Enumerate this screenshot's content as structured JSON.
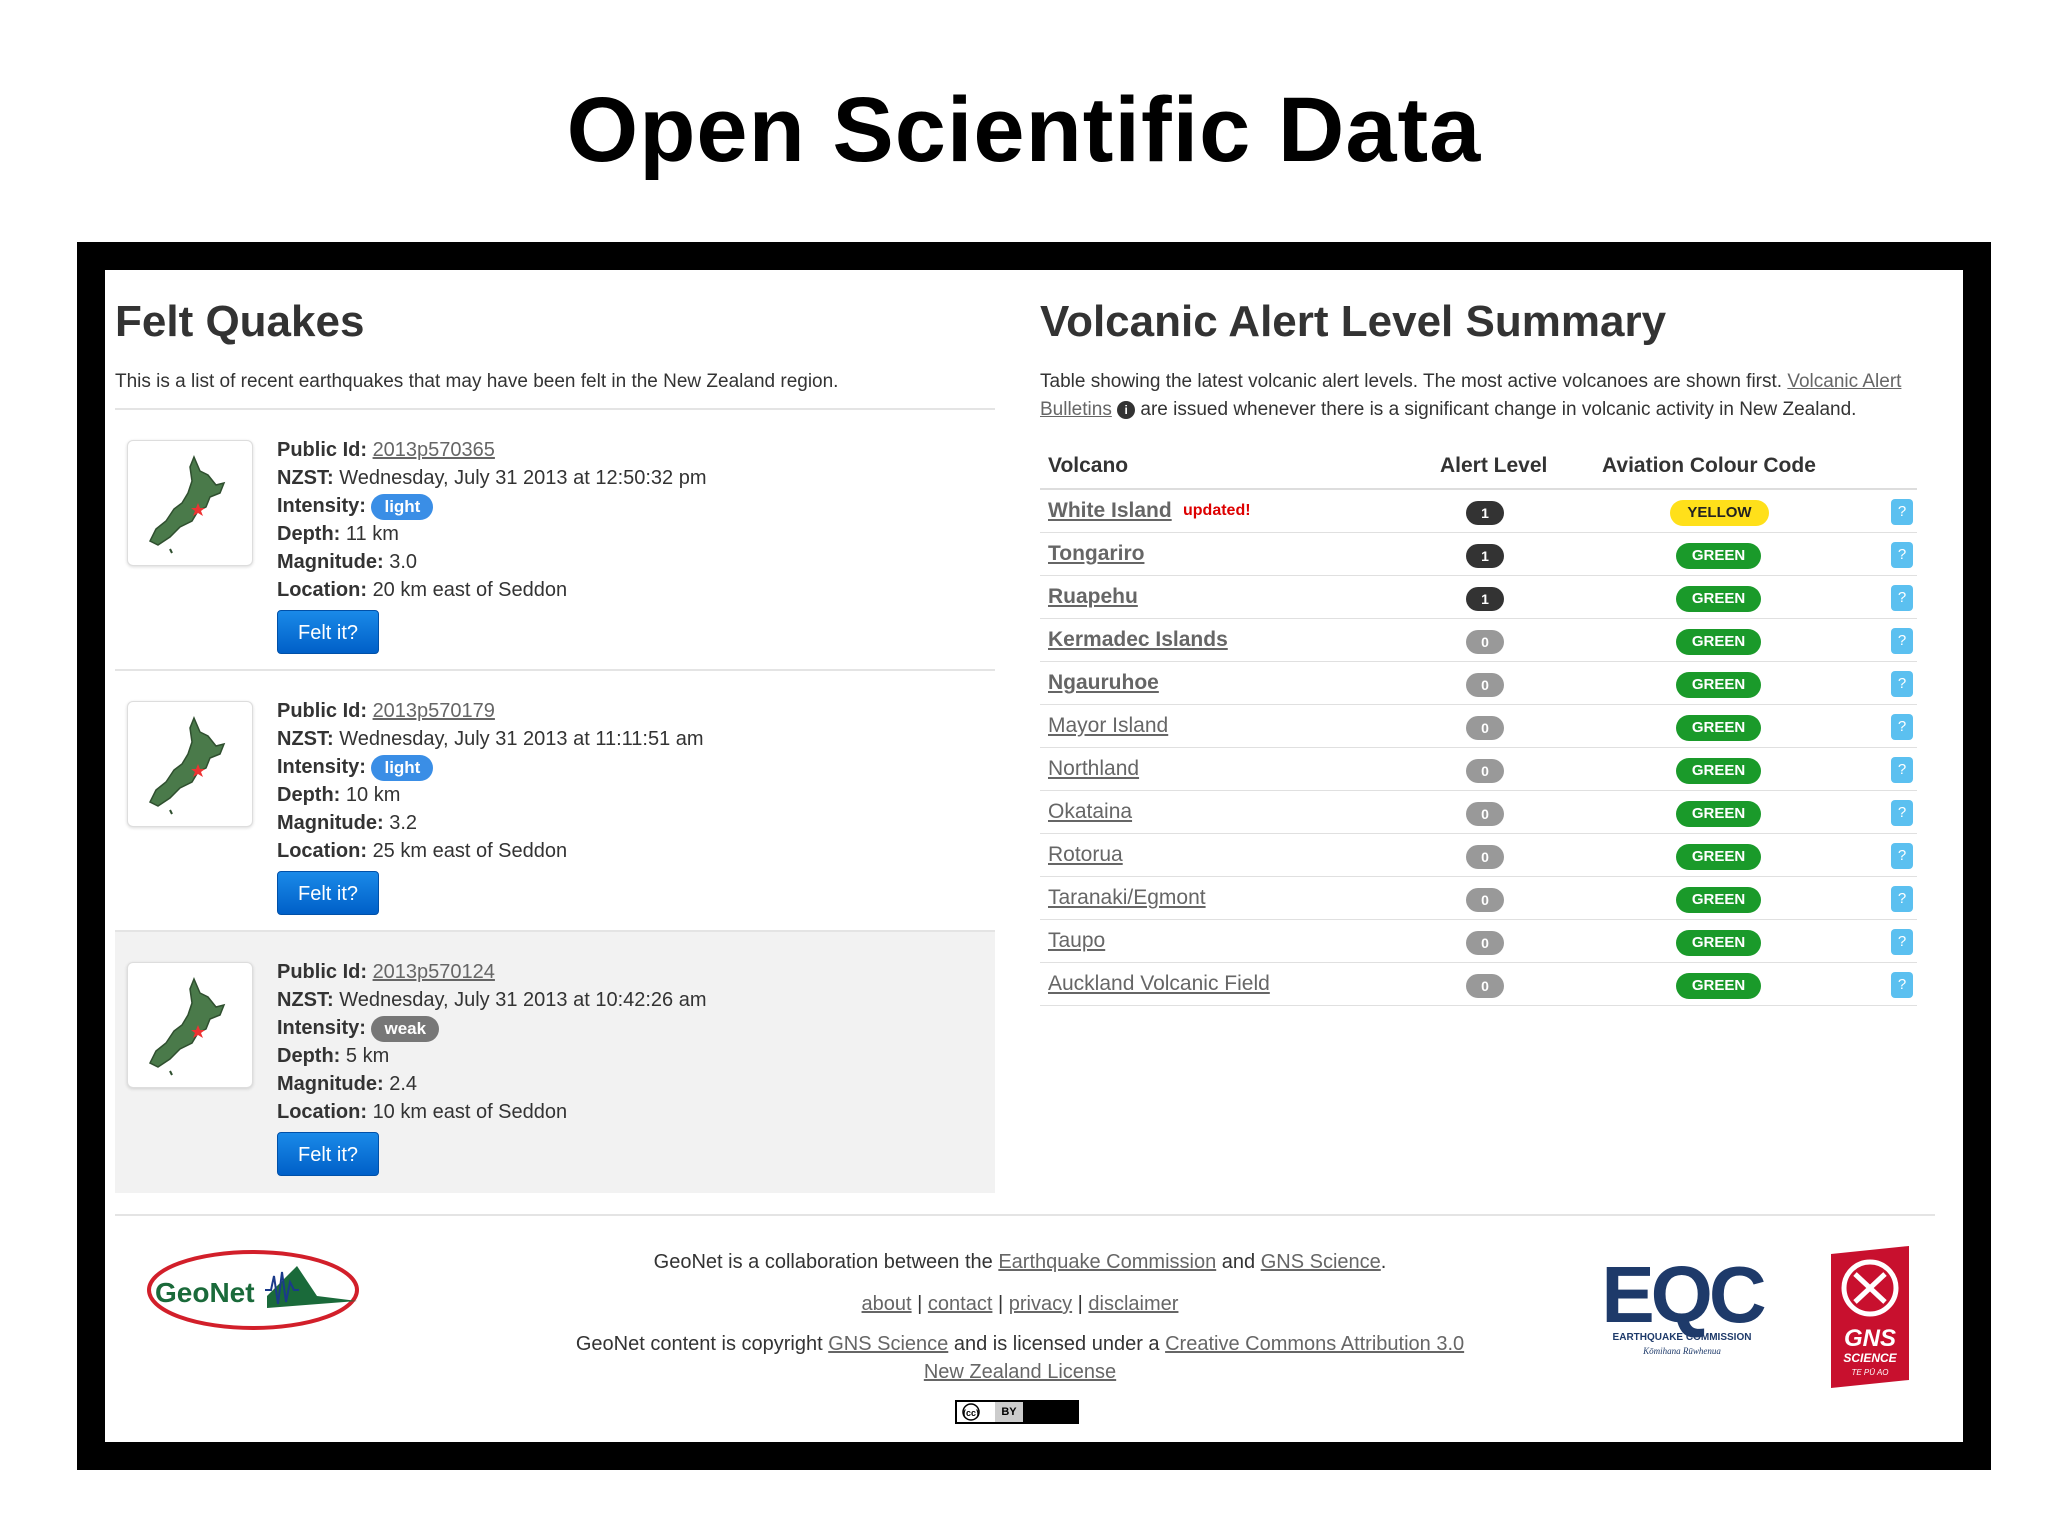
{
  "slide": {
    "title": "Open Scientific Data"
  },
  "felt": {
    "heading": "Felt Quakes",
    "intro": "This is a list of recent earthquakes that may have been felt in the New Zealand region.",
    "labels": {
      "public_id": "Public Id:",
      "nzst": "NZST:",
      "intensity": "Intensity:",
      "depth": "Depth:",
      "magnitude": "Magnitude:",
      "location": "Location:",
      "felt_button": "Felt it?"
    },
    "quakes": [
      {
        "public_id": "2013p570365",
        "nzst": "Wednesday, July 31 2013 at 12:50:32 pm",
        "intensity": "light",
        "depth": "11 km",
        "magnitude": "3.0",
        "location": "20 km east of Seddon"
      },
      {
        "public_id": "2013p570179",
        "nzst": "Wednesday, July 31 2013 at 11:11:51 am",
        "intensity": "light",
        "depth": "10 km",
        "magnitude": "3.2",
        "location": "25 km east of Seddon"
      },
      {
        "public_id": "2013p570124",
        "nzst": "Wednesday, July 31 2013 at 10:42:26 am",
        "intensity": "weak",
        "depth": "5 km",
        "magnitude": "2.4",
        "location": "10 km east of Seddon"
      }
    ]
  },
  "volcanic": {
    "heading": "Volcanic Alert Level Summary",
    "intro_pre": "Table showing the latest volcanic alert levels. The most active volcanoes are shown first.",
    "intro_link": "Volcanic Alert Bulletins",
    "intro_post": "are issued whenever there is a significant change in volcanic activity in New Zealand.",
    "info_glyph": "i",
    "columns": {
      "volcano": "Volcano",
      "alert_level": "Alert Level",
      "colour_code": "Aviation Colour Code"
    },
    "help_glyph": "?",
    "updated_label": "updated!",
    "rows": [
      {
        "name": "White Island",
        "level": "1",
        "code": "YELLOW",
        "updated": true,
        "bold": true
      },
      {
        "name": "Tongariro",
        "level": "1",
        "code": "GREEN",
        "bold": true
      },
      {
        "name": "Ruapehu",
        "level": "1",
        "code": "GREEN",
        "bold": true
      },
      {
        "name": "Kermadec Islands",
        "level": "0",
        "code": "GREEN",
        "bold": true
      },
      {
        "name": "Ngauruhoe",
        "level": "0",
        "code": "GREEN",
        "bold": true
      },
      {
        "name": "Mayor Island",
        "level": "0",
        "code": "GREEN"
      },
      {
        "name": "Northland",
        "level": "0",
        "code": "GREEN"
      },
      {
        "name": "Okataina",
        "level": "0",
        "code": "GREEN"
      },
      {
        "name": "Rotorua",
        "level": "0",
        "code": "GREEN"
      },
      {
        "name": "Taranaki/Egmont",
        "level": "0",
        "code": "GREEN"
      },
      {
        "name": "Taupo",
        "level": "0",
        "code": "GREEN"
      },
      {
        "name": "Auckland Volcanic Field",
        "level": "0",
        "code": "GREEN"
      }
    ]
  },
  "footer": {
    "collab_pre": "GeoNet is a collaboration between the",
    "collab_link1": "Earthquake Commission",
    "collab_and": "and",
    "collab_link2": "GNS Science",
    "collab_end": ".",
    "links": [
      "about",
      "contact",
      "privacy",
      "disclaimer"
    ],
    "sep": "|",
    "copy_pre": "GeoNet content is copyright",
    "copy_link1": "GNS Science",
    "copy_mid": "and is licensed under a",
    "copy_link2": "Creative Commons Attribution 3.0 New Zealand License",
    "cc_text": "(cc)",
    "cc_by": "BY",
    "geonet_logo_text": "GeoNet",
    "eqc_logo_text": "EQC",
    "eqc_sub": "EARTHQUAKE COMMISSION",
    "eqc_sub2": "Kōmihana Rūwhenua",
    "gns_logo_text": "GNS",
    "gns_sub": "SCIENCE",
    "gns_sub2": "TE PŪ AO"
  },
  "colors": {
    "light_badge": "#3a8ee6",
    "weak_badge": "#777777",
    "green_code": "#1a9a2a",
    "yellow_code": "#ffe01a",
    "button_blue": "#0a74da",
    "help_blue": "#5bc0f0"
  }
}
